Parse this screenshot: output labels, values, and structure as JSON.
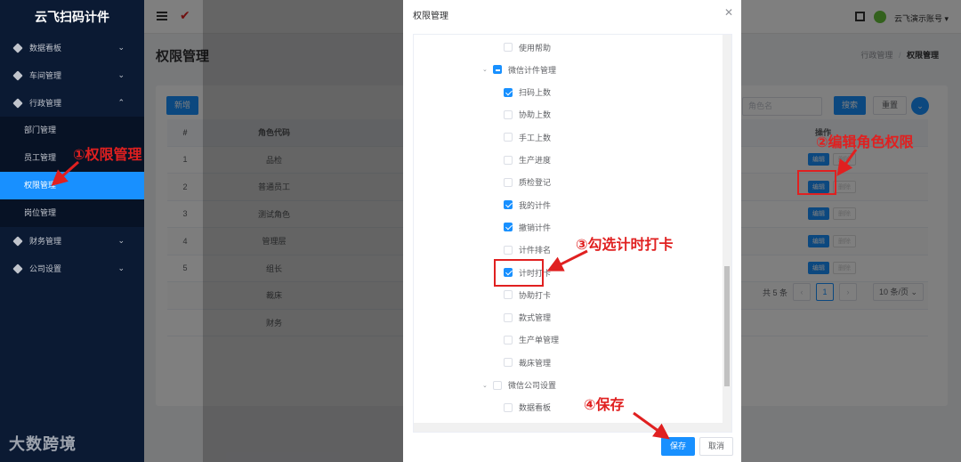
{
  "sidebar": {
    "logo": "云飞扫码计件",
    "items": [
      {
        "label": "数据看板",
        "chev": "⌄"
      },
      {
        "label": "车间管理",
        "chev": "⌄"
      },
      {
        "label": "行政管理",
        "chev": "⌃"
      },
      {
        "label": "财务管理",
        "chev": "⌄"
      },
      {
        "label": "公司设置",
        "chev": "⌄"
      }
    ],
    "sub_items": [
      "部门管理",
      "员工管理",
      "权限管理",
      "岗位管理"
    ],
    "watermark": "大数跨境"
  },
  "header": {
    "account": "云飞演示账号 ▾"
  },
  "page": {
    "title": "权限管理",
    "breadcrumb_parent": "行政管理",
    "breadcrumb_sep": "/",
    "breadcrumb_current": "权限管理"
  },
  "toolbar": {
    "add": "新增",
    "search_placeholder": "角色名",
    "search": "搜索",
    "reset": "重置",
    "toggle": "⌄"
  },
  "table": {
    "columns": [
      "#",
      "角色代码",
      "操作"
    ],
    "rows": [
      {
        "idx": "1",
        "code": "品检"
      },
      {
        "idx": "2",
        "code": "普通员工"
      },
      {
        "idx": "3",
        "code": "测试角色"
      },
      {
        "idx": "4",
        "code": "管理层"
      },
      {
        "idx": "5",
        "code": "组长"
      },
      {
        "idx": "",
        "code": "裁床"
      },
      {
        "idx": "",
        "code": "财务"
      }
    ],
    "edit_label": "编辑",
    "delete_label": "删除"
  },
  "pagination": {
    "total": "共 5 条",
    "prev": "‹",
    "current": "1",
    "next": "›",
    "page_size": "10 条/页 ⌄"
  },
  "dialog": {
    "title": "权限管理",
    "close": "✕",
    "nodes": [
      {
        "label": "使用帮助",
        "state": "off",
        "level": 2
      },
      {
        "label": "微信计件管理",
        "state": "half",
        "level": 1,
        "caret": "⌄"
      },
      {
        "label": "扫码上数",
        "state": "on",
        "level": 2
      },
      {
        "label": "协助上数",
        "state": "off",
        "level": 2
      },
      {
        "label": "手工上数",
        "state": "off",
        "level": 2
      },
      {
        "label": "生产进度",
        "state": "off",
        "level": 2
      },
      {
        "label": "质检登记",
        "state": "off",
        "level": 2
      },
      {
        "label": "我的计件",
        "state": "on",
        "level": 2
      },
      {
        "label": "撤销计件",
        "state": "on",
        "level": 2
      },
      {
        "label": "计件排名",
        "state": "off",
        "level": 2
      },
      {
        "label": "计时打卡",
        "state": "on",
        "level": 2
      },
      {
        "label": "协助打卡",
        "state": "off",
        "level": 2
      },
      {
        "label": "款式管理",
        "state": "off",
        "level": 2
      },
      {
        "label": "生产单管理",
        "state": "off",
        "level": 2
      },
      {
        "label": "裁床管理",
        "state": "off",
        "level": 2
      },
      {
        "label": "微信公司设置",
        "state": "off",
        "level": 1,
        "caret": "⌄"
      },
      {
        "label": "数据看板",
        "state": "off",
        "level": 2
      }
    ],
    "save": "保存",
    "cancel": "取消"
  },
  "annotations": {
    "a1": "①权限管理",
    "a2": "②编辑角色权限",
    "a3": "③勾选计时打卡",
    "a4": "④保存"
  },
  "colors": {
    "primary": "#1890ff",
    "sidebar_bg": "#0b1a33",
    "annotation_red": "#e02020"
  }
}
